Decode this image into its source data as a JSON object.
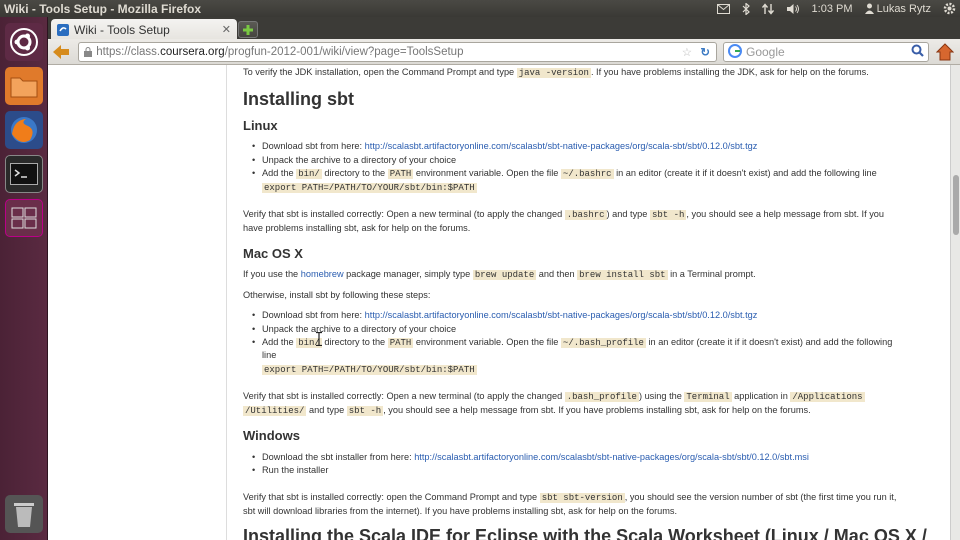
{
  "os": {
    "window_title": "Wiki - Tools Setup - Mozilla Firefox",
    "time": "1:03 PM",
    "user": "Lukas Rytz"
  },
  "browser": {
    "tab_title": "Wiki - Tools Setup",
    "url_prefix": "https://class.",
    "url_domain": "coursera.org",
    "url_path": "/progfun-2012-001/wiki/view?page=ToolsSetup",
    "search_placeholder": "Google"
  },
  "page": {
    "jdk_a": "To verify the JDK installation, open the Command Prompt and type ",
    "jdk_code": "java -version",
    "jdk_b": ". If you have problems installing the JDK, ask for help on the forums.",
    "h_install_sbt": "Installing sbt",
    "h_linux": "Linux",
    "linux_dl": "Download sbt from here: ",
    "linux_dl_link": "http://scalasbt.artifactoryonline.com/scalasbt/sbt-native-packages/org/scala-sbt/sbt/0.12.0/sbt.tgz",
    "unpack": "Unpack the archive to a directory of your choice",
    "add_a": "Add the ",
    "add_code1": "bin/",
    "add_b": " directory to the ",
    "add_code2": "PATH",
    "add_c": " environment variable. Open the file ",
    "linux_rc": "~/.bashrc",
    "linux_add_d": " in an editor (create it if it doesn't exist) and add the following line",
    "export": "export PATH=/PATH/TO/YOUR/sbt/bin:$PATH",
    "linux_v1a": "Verify that sbt is installed correctly: Open a new terminal (to apply the changed ",
    "linux_v1code": ".bashrc",
    "linux_v1b": ") and type ",
    "sbt_h": "sbt -h",
    "linux_v1c": ", you should see a help message from sbt. If you",
    "linux_v2": "have problems installing sbt, ask for help on the forums.",
    "h_mac": "Mac OS X",
    "mac_a": "If you use the ",
    "mac_link": "homebrew",
    "mac_b": " package manager, simply type ",
    "mac_code1": "brew update",
    "mac_c": " and then ",
    "mac_code2": "brew install sbt",
    "mac_d": " in a Terminal prompt.",
    "mac_otherwise": "Otherwise, install sbt by following these steps:",
    "mac_dl": "Download sbt from here: ",
    "mac_dl_link": "http://scalasbt.artifactoryonline.com/scalasbt/sbt-native-packages/org/scala-sbt/sbt/0.12.0/sbt.tgz",
    "mac_rc": "~/.bash_profile",
    "mac_add_d": " in an editor (create it if it doesn't exist) and add the following",
    "mac_add_line": "line",
    "mac_v1a": "Verify that sbt is installed correctly: Open a new terminal (to apply the changed ",
    "mac_v1code": ".bash_profile",
    "mac_v1b": ") using the ",
    "mac_v1code2": "Terminal",
    "mac_v1c": " application in ",
    "mac_v1code3": "/Applications",
    "mac_v2code": "/Utilities/",
    "mac_v2a": " and type ",
    "mac_v2b": ", you should see a help message from sbt. If you have problems installing sbt, ask for help on the forums.",
    "h_windows": "Windows",
    "win_dl": "Download the sbt installer from here: ",
    "win_dl_link": "http://scalasbt.artifactoryonline.com/scalasbt/sbt-native-packages/org/scala-sbt/sbt/0.12.0/sbt.msi",
    "win_run": "Run the installer",
    "win_v1a": "Verify that sbt is installed correctly: open the Command Prompt and type ",
    "win_v1code": "sbt sbt-version",
    "win_v1b": ", you should see the version number of sbt (the first time you run it,",
    "win_v2": "sbt will download libraries from the internet). If you have problems installing sbt, ask for help on the forums.",
    "h_ide": "Installing the Scala IDE for Eclipse with the Scala Worksheet (Linux / Mac OS X /"
  }
}
